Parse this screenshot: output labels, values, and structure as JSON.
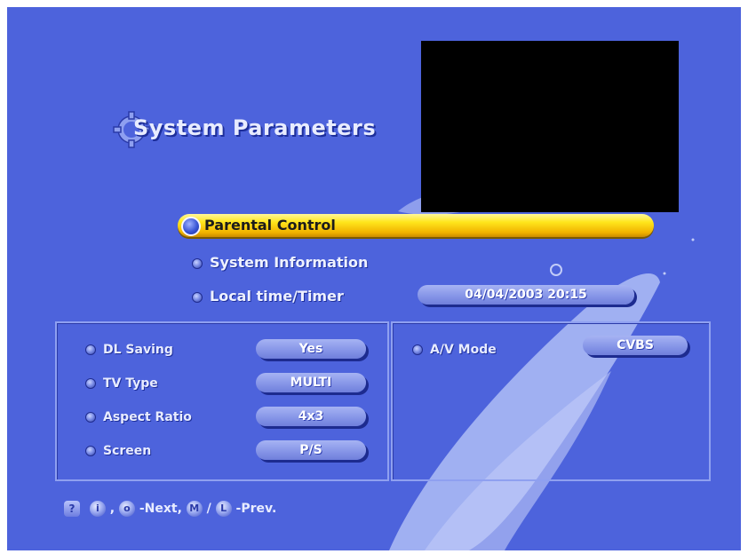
{
  "title": "System Parameters",
  "menu": {
    "selected": "Parental Control",
    "items": [
      "System Information",
      "Local time/Timer"
    ],
    "datetime": "04/04/2003 20:15"
  },
  "left_panel": [
    {
      "label": "DL Saving",
      "value": "Yes"
    },
    {
      "label": "TV Type",
      "value": "MULTI"
    },
    {
      "label": "Aspect Ratio",
      "value": "4x3"
    },
    {
      "label": "Screen",
      "value": "P/S"
    }
  ],
  "right_panel": {
    "label": "A/V Mode",
    "value": "CVBS"
  },
  "footer": {
    "help_key": "?",
    "key1": "i",
    "key2": "o",
    "next_text": "-Next,",
    "key3": "M",
    "slash": "/",
    "key4": "L",
    "prev_text": "-Prev."
  },
  "colors": {
    "background": "#4d63dc",
    "highlight": "#ffe61c",
    "pill": "#8796e8"
  }
}
